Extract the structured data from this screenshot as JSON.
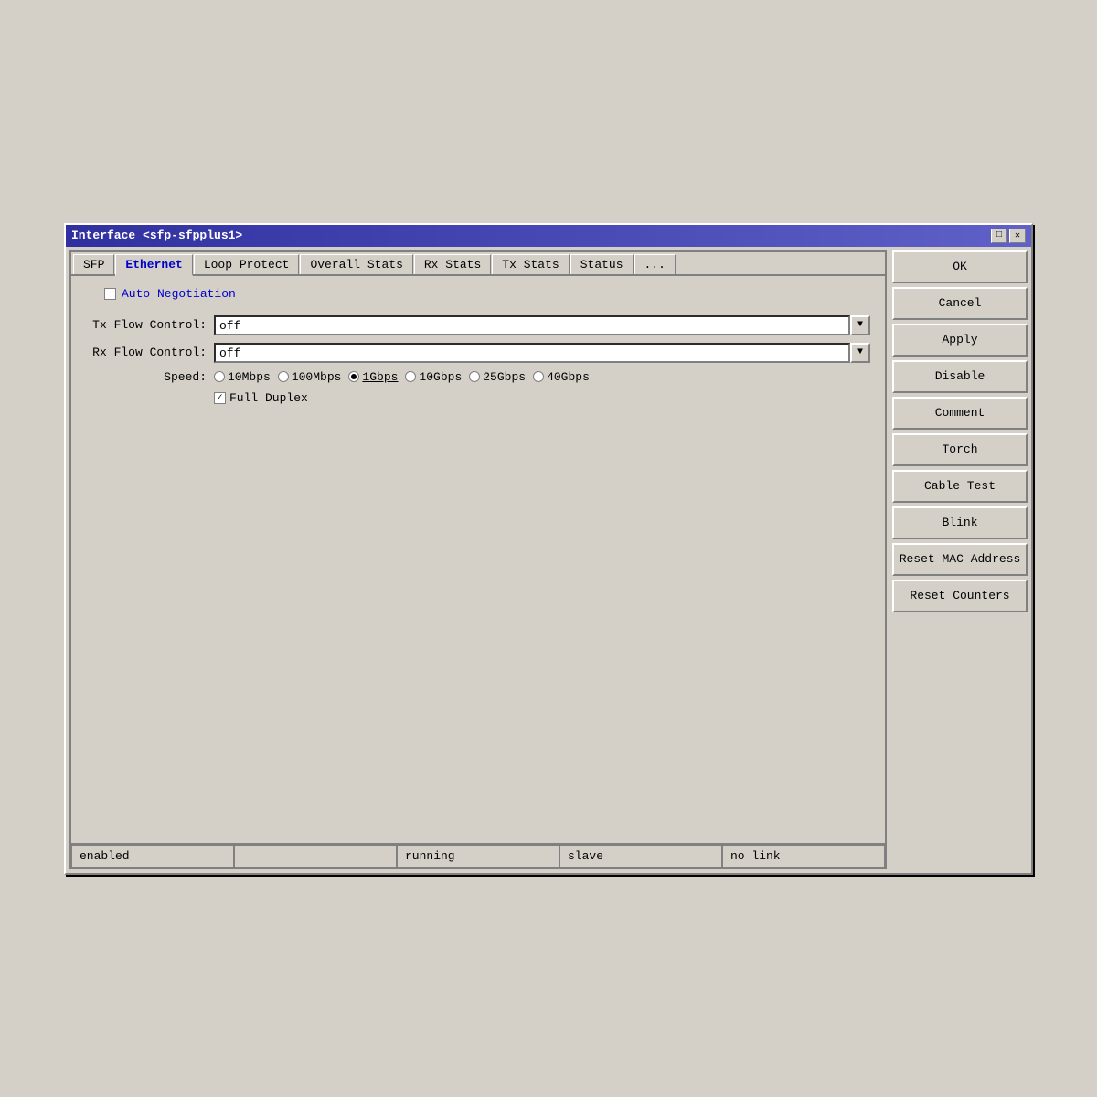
{
  "titlebar": {
    "title": "Interface <sfp-sfpplus1>",
    "minimize_label": "□",
    "close_label": "✕"
  },
  "tabs": [
    {
      "label": "SFP",
      "active": false
    },
    {
      "label": "Ethernet",
      "active": true
    },
    {
      "label": "Loop Protect",
      "active": false
    },
    {
      "label": "Overall Stats",
      "active": false
    },
    {
      "label": "Rx Stats",
      "active": false
    },
    {
      "label": "Tx Stats",
      "active": false
    },
    {
      "label": "Status",
      "active": false
    },
    {
      "label": "...",
      "active": false
    }
  ],
  "auto_negotiation": {
    "label": "Auto Negotiation",
    "checked": false
  },
  "tx_flow_control": {
    "label": "Tx Flow Control:",
    "value": "off"
  },
  "rx_flow_control": {
    "label": "Rx Flow Control:",
    "value": "off"
  },
  "speed": {
    "label": "Speed:",
    "options": [
      {
        "label": "10Mbps",
        "selected": false
      },
      {
        "label": "100Mbps",
        "selected": false
      },
      {
        "label": "1Gbps",
        "selected": true
      },
      {
        "label": "10Gbps",
        "selected": false
      },
      {
        "label": "25Gbps",
        "selected": false
      },
      {
        "label": "40Gbps",
        "selected": false
      }
    ]
  },
  "full_duplex": {
    "label": "Full Duplex",
    "checked": true
  },
  "sidebar_buttons": [
    {
      "label": "OK",
      "name": "ok-button"
    },
    {
      "label": "Cancel",
      "name": "cancel-button"
    },
    {
      "label": "Apply",
      "name": "apply-button"
    },
    {
      "label": "Disable",
      "name": "disable-button"
    },
    {
      "label": "Comment",
      "name": "comment-button"
    },
    {
      "label": "Torch",
      "name": "torch-button"
    },
    {
      "label": "Cable Test",
      "name": "cable-test-button"
    },
    {
      "label": "Blink",
      "name": "blink-button"
    },
    {
      "label": "Reset MAC Address",
      "name": "reset-mac-button"
    },
    {
      "label": "Reset Counters",
      "name": "reset-counters-button"
    }
  ],
  "status_bar": [
    {
      "label": "enabled",
      "name": "status-enabled"
    },
    {
      "label": "",
      "name": "status-empty"
    },
    {
      "label": "running",
      "name": "status-running"
    },
    {
      "label": "slave",
      "name": "status-slave"
    },
    {
      "label": "no link",
      "name": "status-link"
    }
  ]
}
